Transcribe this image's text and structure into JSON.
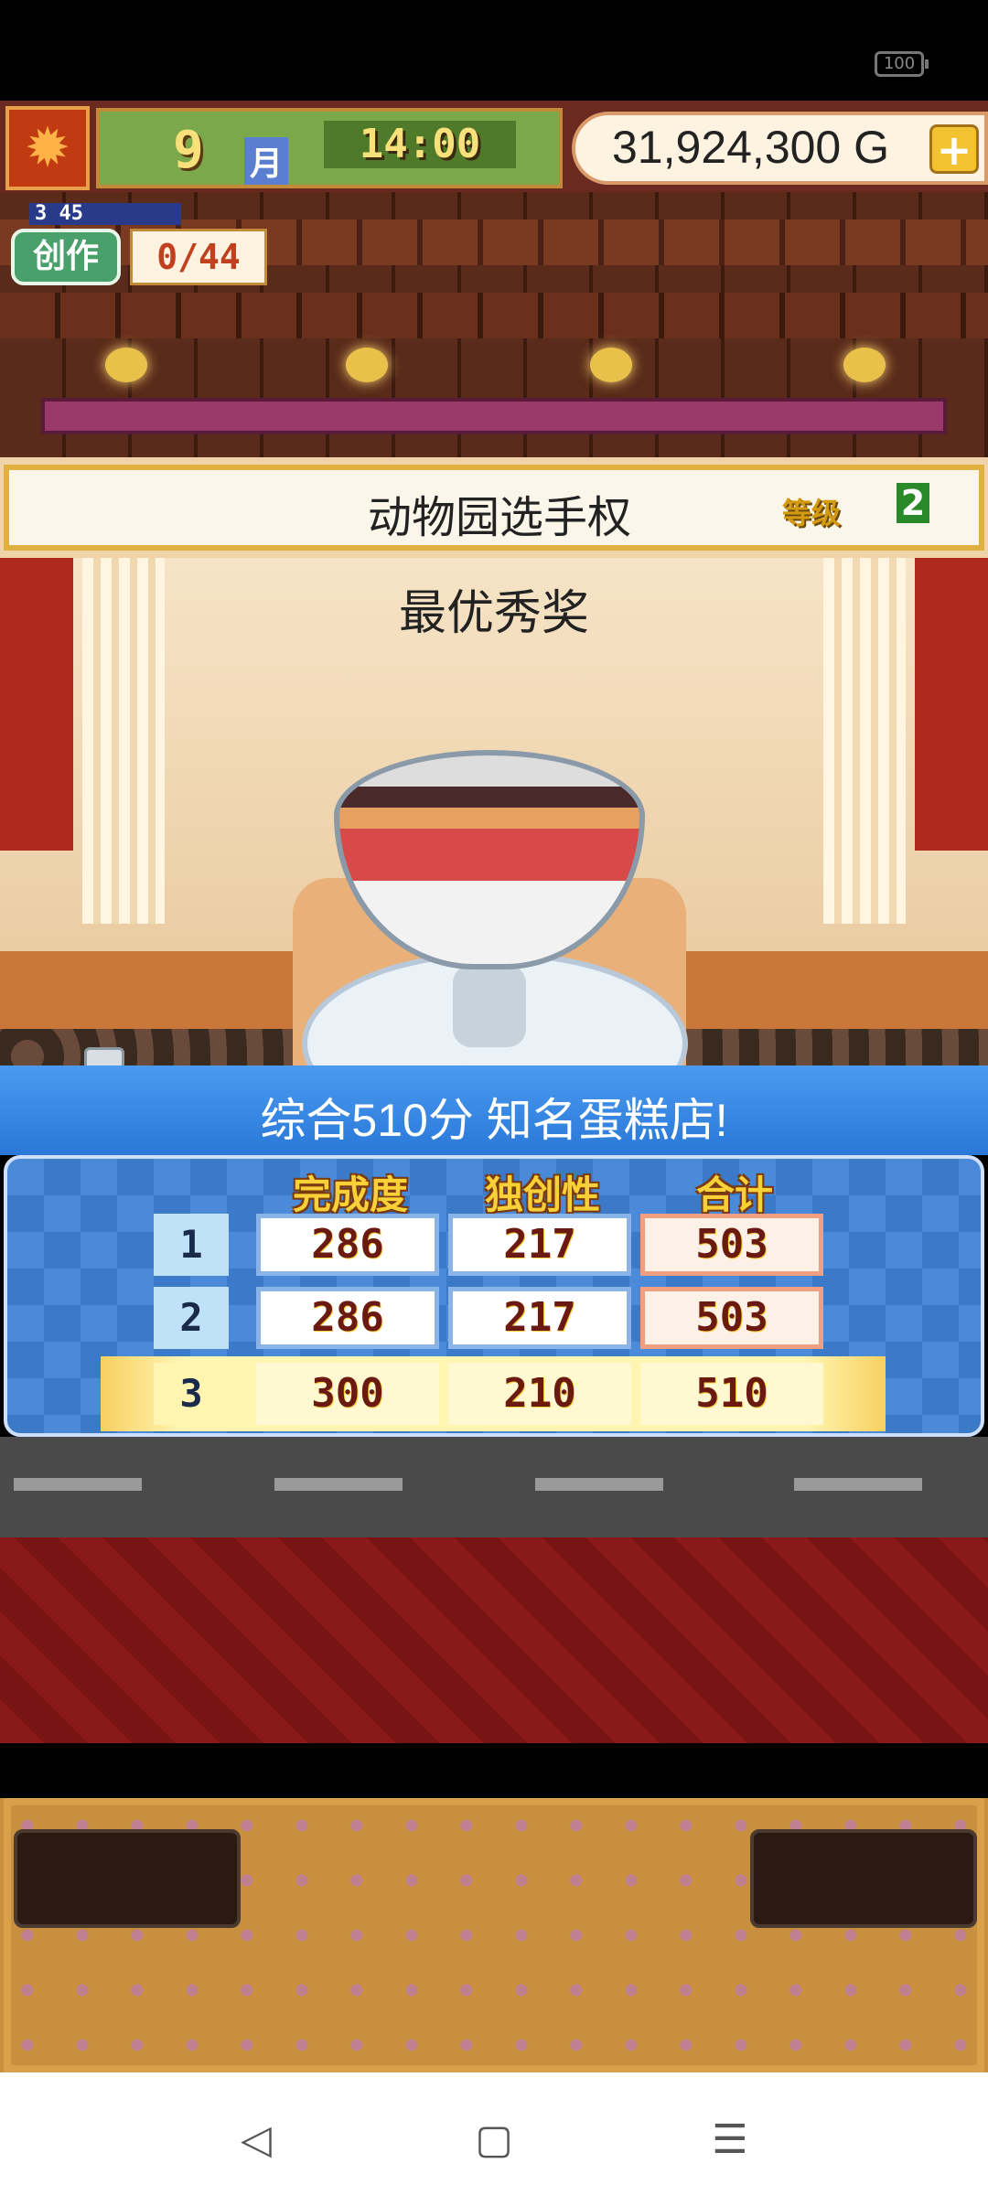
{
  "status_bar": {
    "battery": "100"
  },
  "hud": {
    "month_number": "9",
    "month_label": "月",
    "time": "14:00",
    "money": "31,924,300 G",
    "add_button": "+"
  },
  "create": {
    "progress_top": "3 45",
    "badge": "创作",
    "count": "0/44"
  },
  "contest": {
    "title": "动物园选手权",
    "grade_label": "等级",
    "grade_value": "2",
    "award": "最优秀奖"
  },
  "results": {
    "summary": "综合510分 知名蛋糕店!",
    "columns": [
      "完成度",
      "独创性",
      "合计"
    ],
    "rows": [
      {
        "rank": "1",
        "completion": "286",
        "originality": "217",
        "total": "503"
      },
      {
        "rank": "2",
        "completion": "286",
        "originality": "217",
        "total": "503"
      },
      {
        "rank": "3",
        "completion": "300",
        "originality": "210",
        "total": "510"
      }
    ]
  },
  "navbar": {
    "back": "◁",
    "home": "▢",
    "menu": "☰"
  },
  "colors": {
    "header_blue": "#2a78d8",
    "gold": "#f8d038",
    "hud_green": "#7aa84a"
  }
}
